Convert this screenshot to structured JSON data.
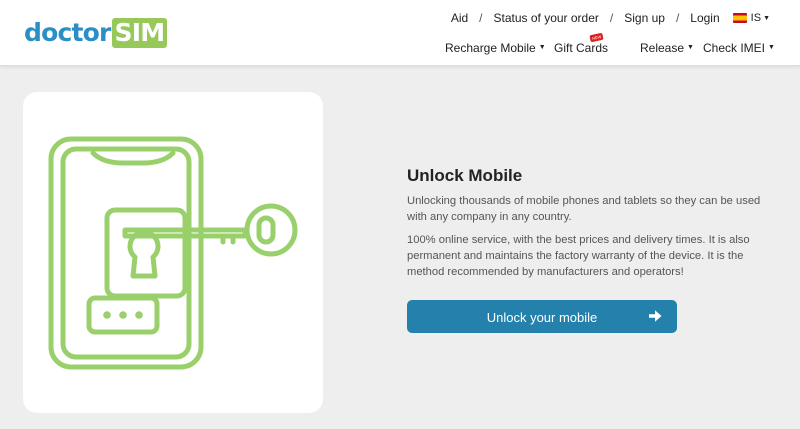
{
  "brand": {
    "part1": "doctor",
    "part2": "SIM"
  },
  "topnav": {
    "aid": "Aid",
    "status": "Status of your order",
    "signup": "Sign up",
    "login": "Login",
    "separator": "/",
    "lang": "IS"
  },
  "menu": {
    "recharge": "Recharge Mobile",
    "gift": "Gift Cards",
    "gift_badge": "NEW",
    "release": "Release",
    "imei": "Check IMEI"
  },
  "hero": {
    "title": "Unlock Mobile",
    "paragraph1": "Unlocking thousands of mobile phones and tablets so they can be used with any company in any country.",
    "paragraph2": "100% online service, with the best prices and delivery times. It is also permanent and maintains the factory warranty of the device. It is the method recommended by manufacturers and operators!",
    "cta": "Unlock your mobile"
  },
  "icons": {
    "flag": "spain-flag-icon",
    "illustration": "phone-key-unlock-icon",
    "cta_arrow": "arrow-right-icon",
    "caret": "caret-down-icon"
  },
  "colors": {
    "brand_blue": "#2a8fc5",
    "brand_green": "#97c95a",
    "illustration_green": "#9ad06b",
    "button": "#2381ab",
    "badge": "#d9211d",
    "page_bg": "#eeeeee"
  }
}
